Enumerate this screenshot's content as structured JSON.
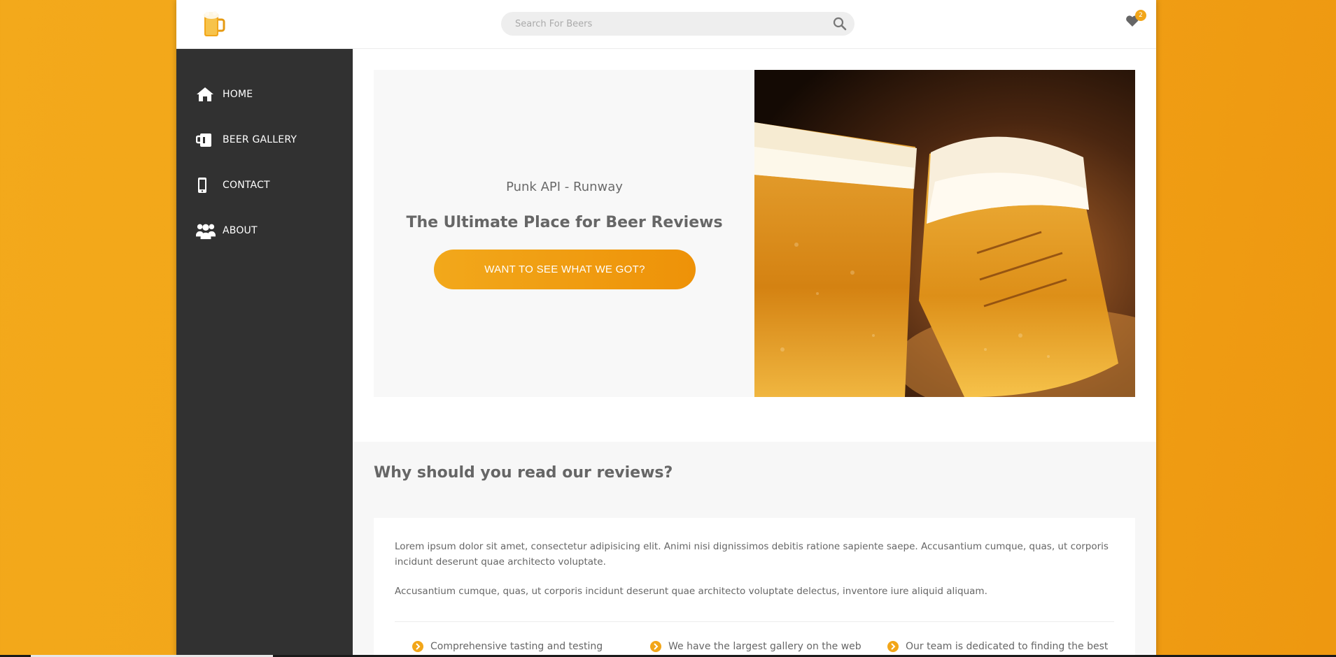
{
  "header": {
    "search": {
      "placeholder": "Search For Beers",
      "value": ""
    },
    "favorites_count": "2"
  },
  "sidebar": {
    "items": [
      {
        "label": "HOME",
        "icon": "home-icon"
      },
      {
        "label": "BEER GALLERY",
        "icon": "beer-mug-icon"
      },
      {
        "label": "CONTACT",
        "icon": "mobile-phone-icon"
      },
      {
        "label": "ABOUT",
        "icon": "users-icon"
      }
    ]
  },
  "hero": {
    "subtitle": "Punk API - Runway",
    "title": "The Ultimate Place for Beer Reviews",
    "cta_label": "WANT TO SEE WHAT WE GOT?"
  },
  "why": {
    "heading": "Why should you read our reviews?",
    "paragraph1": "Lorem ipsum dolor sit amet, consectetur adipisicing elit. Animi nisi dignissimos debitis ratione sapiente saepe. Accusantium cumque, quas, ut corporis incidunt deserunt quae architecto voluptate.",
    "paragraph2": "Accusantium cumque, quas, ut corporis incidunt deserunt quae architecto voluptate delectus, inventore iure aliquid aliquam.",
    "features": [
      "Comprehensive tasting and testing",
      "We have the largest gallery on the web",
      "Our team is dedicated to finding the best"
    ]
  },
  "colors": {
    "accent": "#f2a619",
    "sidebar_bg": "#313131",
    "page_bg": "#f3a91b"
  }
}
